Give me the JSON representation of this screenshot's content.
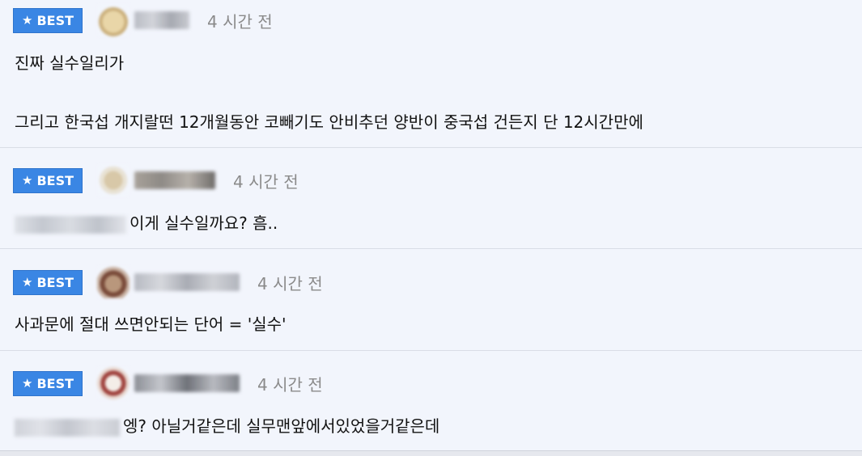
{
  "comments": [
    {
      "badge": "BEST",
      "time": "4 시간 전",
      "lines": [
        "진짜 실수일리가",
        "그리고 한국섭 개지랄떤 12개월동안 코빼기도 안비추던 양반이 중국섭 건든지 단 12시간만에"
      ]
    },
    {
      "badge": "BEST",
      "time": "4 시간 전",
      "lines": [
        "이게 실수일까요? 흠.."
      ]
    },
    {
      "badge": "BEST",
      "time": "4 시간 전",
      "lines": [
        "사과문에 절대 쓰면안되는 단어 = '실수'"
      ]
    },
    {
      "badge": "BEST",
      "time": "4 시간 전",
      "lines": [
        "엥? 아닐거같은데 실무맨앞에서있었을거같은데"
      ]
    }
  ],
  "colors": {
    "badge_bg": "#3a86e4",
    "time_text": "#8a8a8a",
    "page_bg": "#f2f5fc"
  },
  "icons": {
    "badge": "star-icon"
  }
}
